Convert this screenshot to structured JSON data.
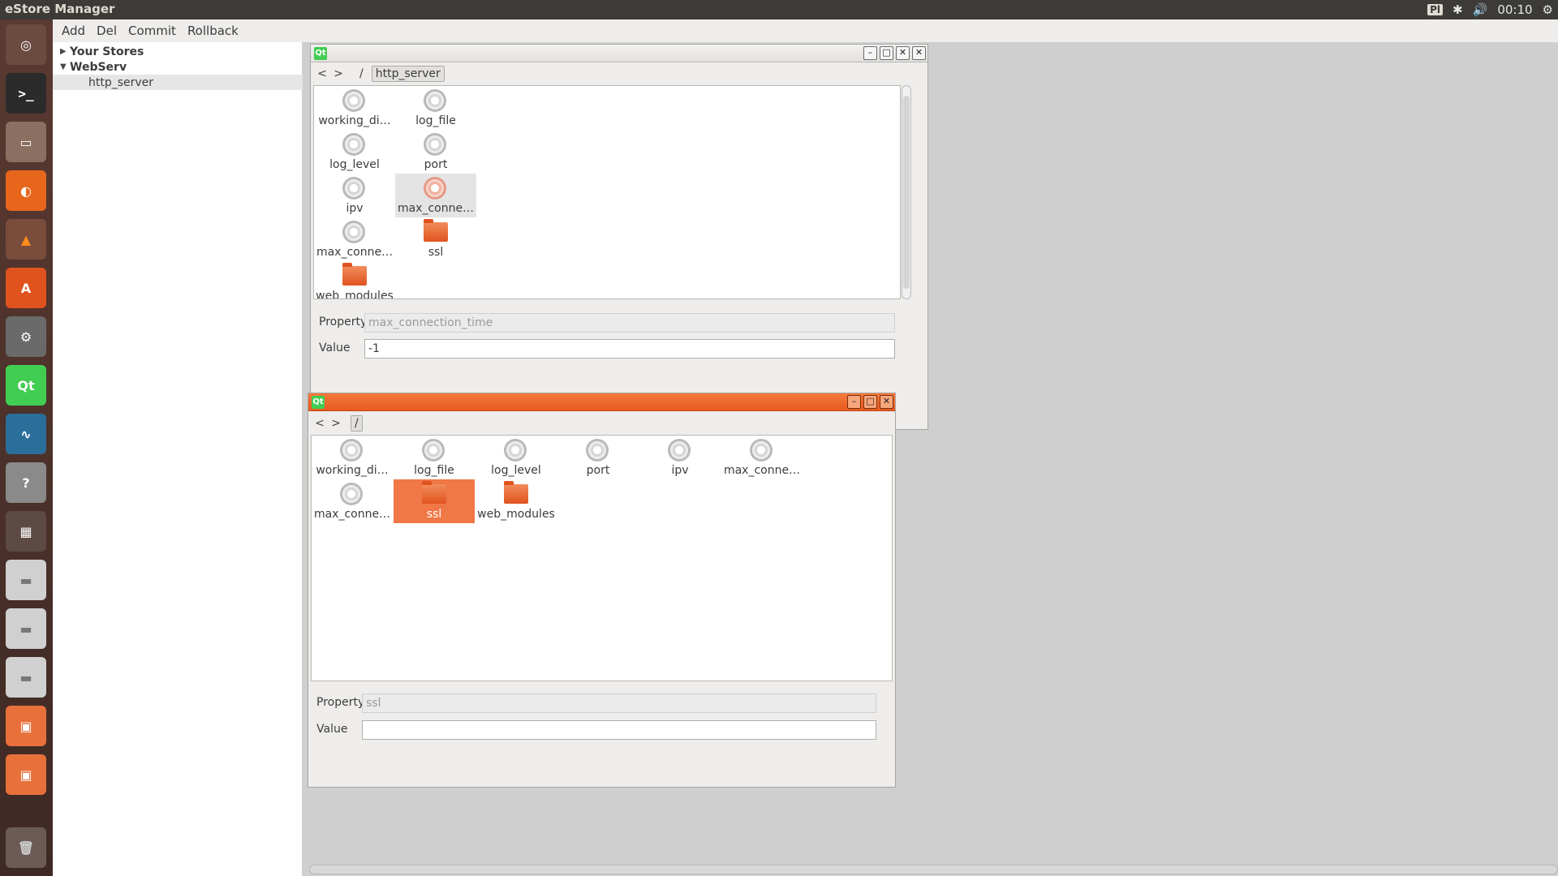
{
  "topbar": {
    "title": "eStore Manager",
    "kbd": "Pl",
    "time": "00:10"
  },
  "launcher": {
    "items": [
      "dash-home",
      "terminal",
      "file-manager",
      "firefox",
      "vlc",
      "software-center",
      "system-settings",
      "qt-creator",
      "system-monitor",
      "help",
      "workspaces",
      "drive",
      "drive",
      "drive",
      "folder-lock",
      "folder-lock",
      "trash"
    ]
  },
  "menubar": {
    "add": "Add",
    "del": "Del",
    "commit": "Commit",
    "rollback": "Rollback"
  },
  "tree": {
    "root1": "Your Stores",
    "root2": "WebServ",
    "child": "http_server"
  },
  "window1": {
    "logo": "Qt",
    "nav": {
      "back": "<",
      "forward": ">",
      "sep": "/",
      "crumb": "http_server"
    },
    "items": [
      {
        "label": "working_di…",
        "type": "gear"
      },
      {
        "label": "log_file",
        "type": "gear"
      },
      {
        "label": "log_level",
        "type": "gear"
      },
      {
        "label": "port",
        "type": "gear"
      },
      {
        "label": "ipv",
        "type": "gear"
      },
      {
        "label": "max_conne…",
        "type": "gear-selected"
      },
      {
        "label": "max_conne…",
        "type": "gear"
      },
      {
        "label": "ssl",
        "type": "folder"
      },
      {
        "label": "web_modules",
        "type": "folder"
      }
    ],
    "property_label": "Property",
    "property_value": "max_connection_time",
    "value_label": "Value",
    "value_value": "-1"
  },
  "window2": {
    "logo": "Qt",
    "nav": {
      "back": "<",
      "forward": ">",
      "crumb": "/"
    },
    "items": [
      {
        "label": "working_di…",
        "type": "gear"
      },
      {
        "label": "log_file",
        "type": "gear"
      },
      {
        "label": "log_level",
        "type": "gear"
      },
      {
        "label": "port",
        "type": "gear"
      },
      {
        "label": "ipv",
        "type": "gear"
      },
      {
        "label": "max_conne…",
        "type": "gear"
      },
      {
        "label": "max_conne…",
        "type": "gear"
      },
      {
        "label": "ssl",
        "type": "folder-selected"
      },
      {
        "label": "web_modules",
        "type": "folder"
      }
    ],
    "property_label": "Property",
    "property_value": "ssl",
    "value_label": "Value",
    "value_value": ""
  },
  "colors": {
    "accent": "#f07746",
    "panel": "#3c3b37",
    "launcher": "#4a302a"
  }
}
